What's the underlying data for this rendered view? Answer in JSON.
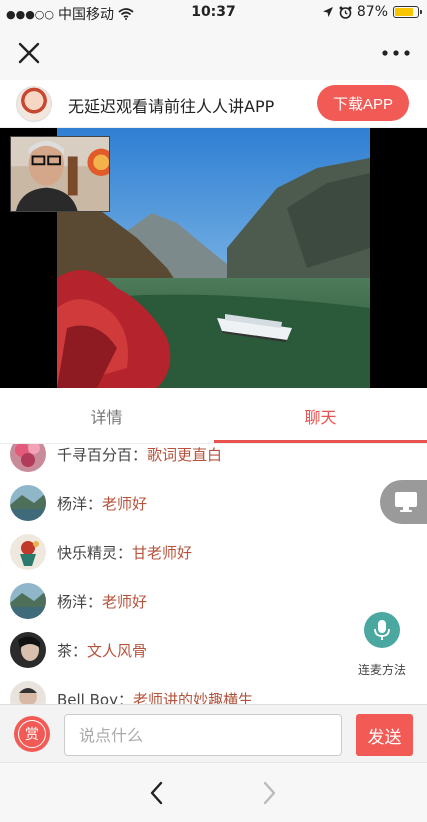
{
  "status_bar": {
    "carrier": "中国移动",
    "time": "10:37",
    "battery_percent": "87%",
    "battery_level": 0.87,
    "icons": [
      "signal-dots-icon",
      "wifi-icon",
      "location-arrow-icon",
      "alarm-icon",
      "battery-icon"
    ]
  },
  "nav": {
    "close_icon": "close-icon",
    "more_icon": "more-dots-icon"
  },
  "banner": {
    "text": "无延迟观看请前往人人讲APP",
    "download_label": "下载APP",
    "colors": {
      "accent": "#f15a55"
    }
  },
  "tabs": {
    "detail_label": "详情",
    "chat_label": "聊天",
    "active": "聊天",
    "active_color": "#e8534f"
  },
  "chat": {
    "messages": [
      {
        "name": "千寻百分百",
        "text": "歌词更直白"
      },
      {
        "name": "杨洋",
        "text": "老师好"
      },
      {
        "name": "快乐精灵",
        "text": "甘老师好"
      },
      {
        "name": "杨洋",
        "text": "老师好"
      },
      {
        "name": "茶",
        "text": "文人风骨"
      },
      {
        "name": "Bell Boy",
        "text": "老师讲的妙趣横生"
      }
    ],
    "separator": "："
  },
  "side_actions": {
    "screen_icon": "screen-icon",
    "mic_icon": "microphone-icon",
    "mic_label": "连麦方法"
  },
  "input_bar": {
    "reward_label": "赏",
    "placeholder": "说点什么",
    "value": "",
    "send_label": "发送"
  },
  "bottom_nav": {
    "back_icon": "chevron-left-icon",
    "forward_icon": "chevron-right-icon"
  }
}
